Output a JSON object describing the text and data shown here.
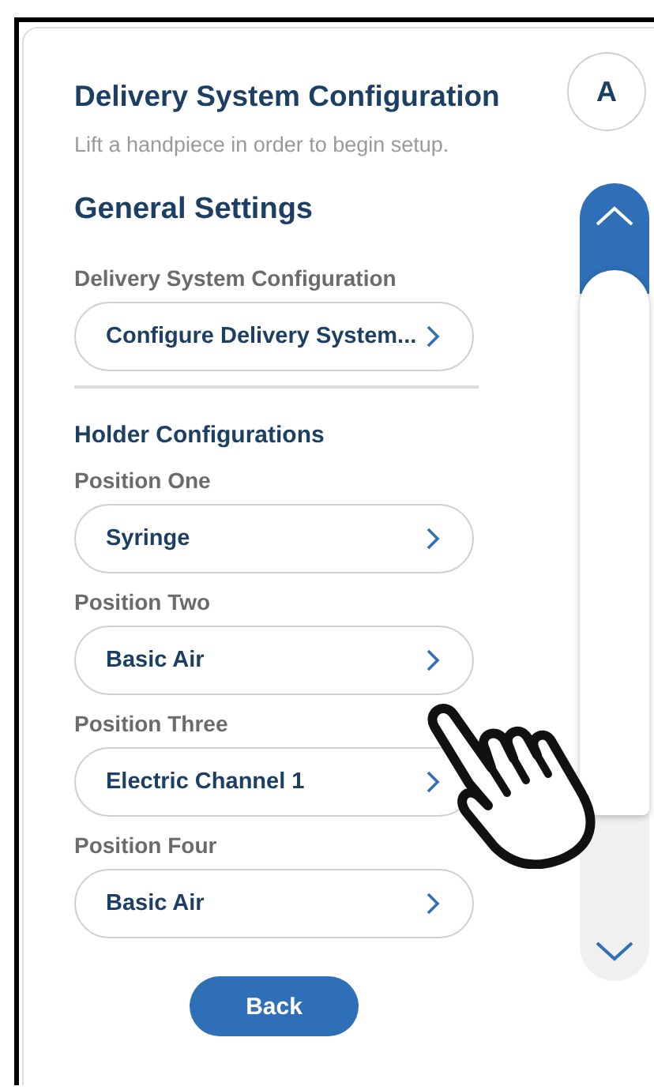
{
  "title": "Delivery System Configuration",
  "subtitle": "Lift a handpiece in order to begin setup.",
  "avatar": "A",
  "sections": [
    {
      "heading": "General Settings",
      "kind": "large",
      "fields": [
        {
          "label": "Delivery System Configuration",
          "value": "Configure Delivery System..."
        }
      ]
    },
    {
      "heading": "Holder Configurations",
      "kind": "small",
      "fields": [
        {
          "label": "Position One",
          "value": "Syringe"
        },
        {
          "label": "Position Two",
          "value": "Basic Air"
        },
        {
          "label": "Position Three",
          "value": "Electric Channel 1"
        },
        {
          "label": "Position Four",
          "value": "Basic Air"
        }
      ]
    }
  ],
  "back_button": "Back"
}
